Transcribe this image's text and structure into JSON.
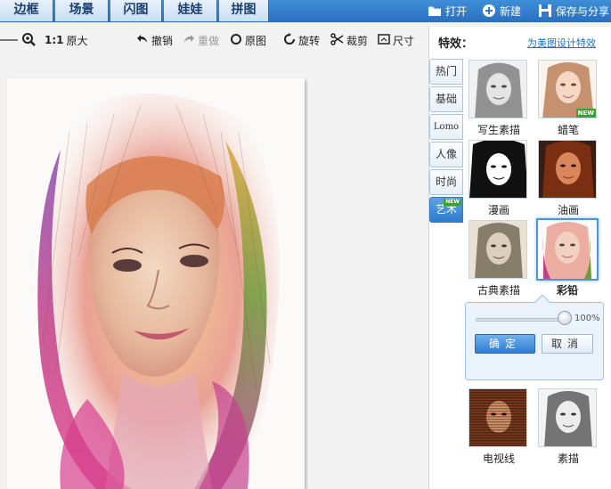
{
  "top_tabs": [
    "边框",
    "场景",
    "闪图",
    "娃娃",
    "拼图"
  ],
  "top_actions": {
    "open": {
      "label": "打开",
      "icon": "folder-icon"
    },
    "new": {
      "label": "新建",
      "icon": "plus-icon"
    },
    "save": {
      "label": "保存与分享",
      "icon": "floppy-icon"
    }
  },
  "toolbar": {
    "zoom_ratio": "1:1",
    "original_size": "原大",
    "undo": "撤销",
    "redo": "重做",
    "original": "原图",
    "rotate": "旋转",
    "crop": "裁剪",
    "resize": "尺寸"
  },
  "panel": {
    "title": "特效：",
    "link": "为美图设计特效",
    "categories": [
      {
        "label": "热门",
        "new": false,
        "active": false
      },
      {
        "label": "基础",
        "new": false,
        "active": false
      },
      {
        "label": "Lomo",
        "new": false,
        "active": false
      },
      {
        "label": "人像",
        "new": false,
        "active": false
      },
      {
        "label": "时尚",
        "new": false,
        "active": false
      },
      {
        "label": "艺术",
        "new": true,
        "active": true
      }
    ],
    "new_badge": "NEW",
    "effects": [
      {
        "label": "写生素描",
        "new": false,
        "selected": false
      },
      {
        "label": "蜡笔",
        "new": true,
        "selected": false
      },
      {
        "label": "漫画",
        "new": false,
        "selected": false
      },
      {
        "label": "油画",
        "new": false,
        "selected": false
      },
      {
        "label": "古典素描",
        "new": false,
        "selected": false
      },
      {
        "label": "彩铅",
        "new": false,
        "selected": true
      },
      {
        "label": "电视线",
        "new": false,
        "selected": false
      },
      {
        "label": "素描",
        "new": false,
        "selected": false
      }
    ]
  },
  "popup": {
    "opacity_value": "100%",
    "opacity_fraction": 1.0,
    "confirm": "确定",
    "cancel": "取消"
  },
  "colors": {
    "topbar": "#2f7bcc",
    "accent": "#4a95df",
    "new_badge": "#3ba133"
  }
}
